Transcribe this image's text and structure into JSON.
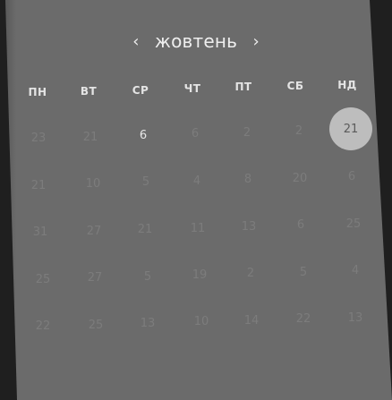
{
  "calendar": {
    "month": "жовтень",
    "prev_icon": "‹",
    "next_icon": "›",
    "weekdays": [
      "ПН",
      "ВТ",
      "СР",
      "ЧТ",
      "ПТ",
      "СБ",
      "НД"
    ],
    "weeks": [
      [
        "23",
        "21",
        "6",
        "6",
        "2",
        "2",
        "21"
      ],
      [
        "21",
        "10",
        "5",
        "4",
        "8",
        "20",
        "6"
      ],
      [
        "31",
        "27",
        "21",
        "11",
        "13",
        "6",
        "25"
      ],
      [
        "25",
        "27",
        "5",
        "19",
        "2",
        "5",
        "4"
      ],
      [
        "22",
        "25",
        "13",
        "10",
        "14",
        "22",
        "13"
      ]
    ]
  }
}
